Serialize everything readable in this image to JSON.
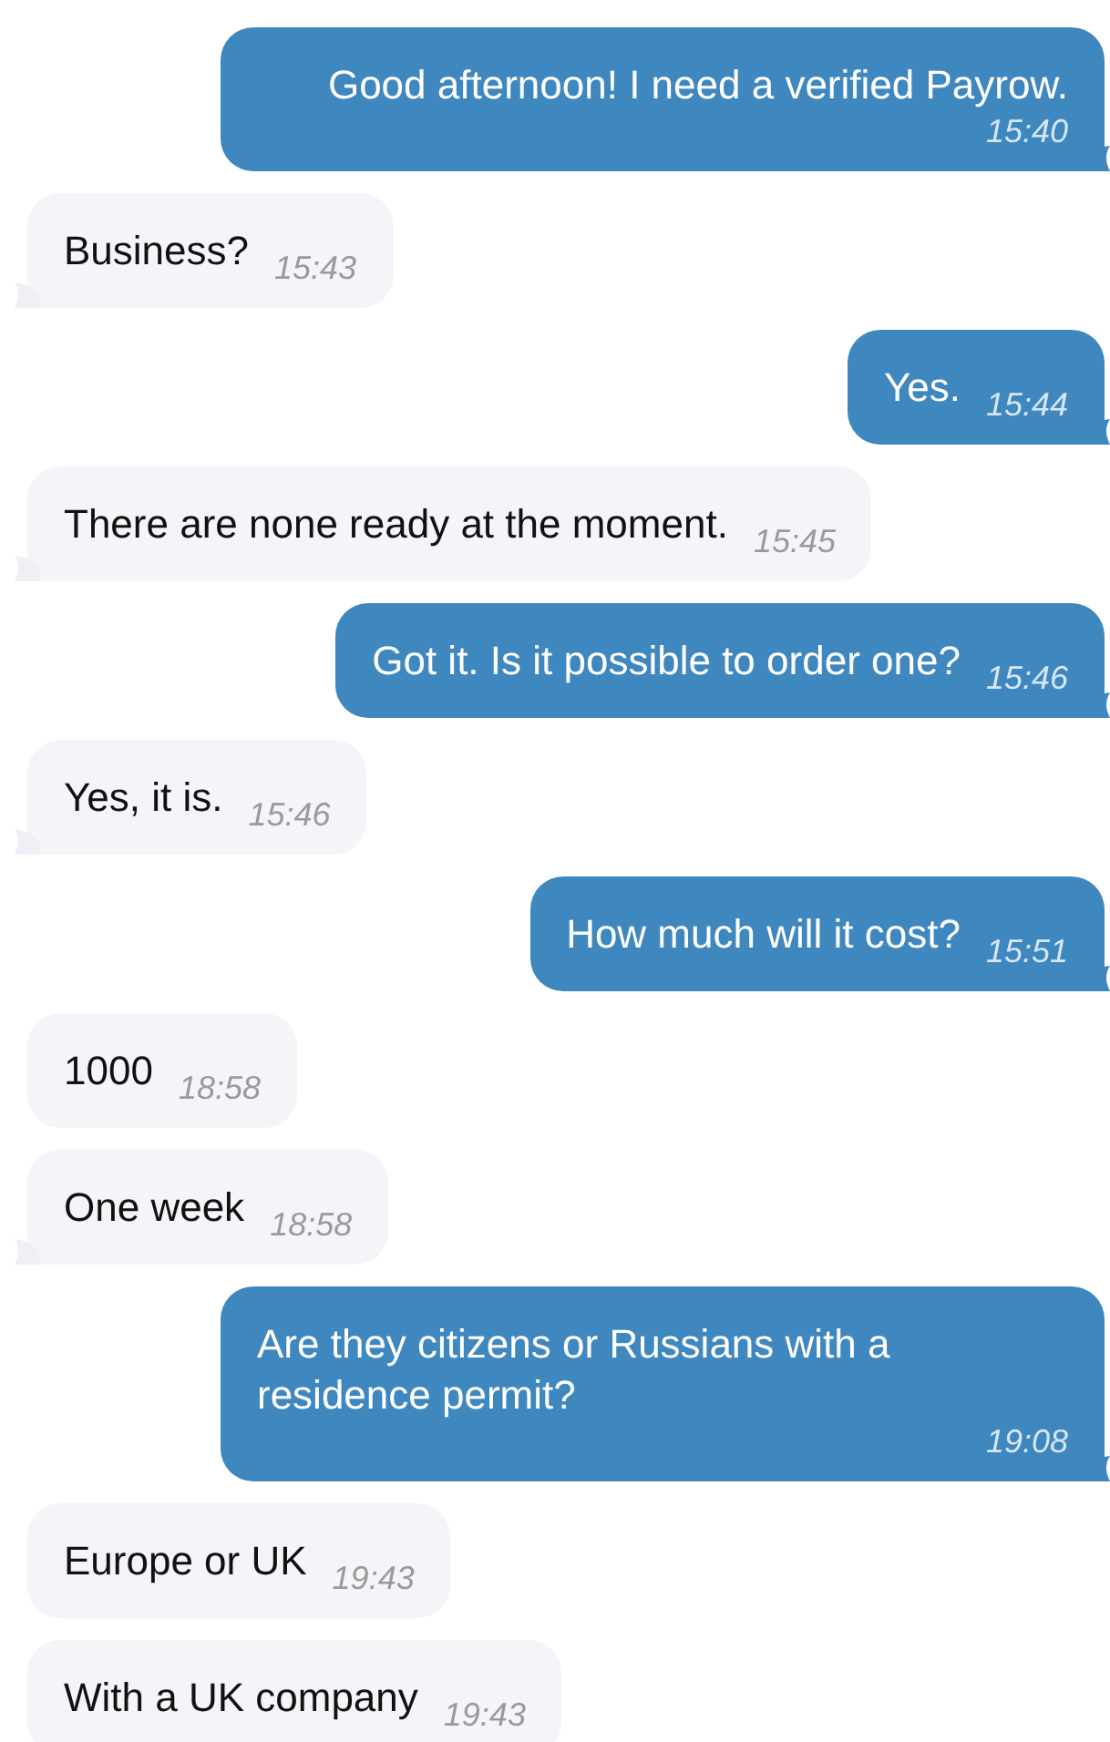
{
  "messages": [
    {
      "kind": "sent",
      "text": "Good afternoon! I need a verified Payrow.",
      "time": "15:40",
      "tail": true
    },
    {
      "kind": "received",
      "text": "Business?",
      "time": "15:43",
      "tail": true
    },
    {
      "kind": "sent",
      "text": "Yes.",
      "time": "15:44",
      "tail": true
    },
    {
      "kind": "received",
      "text": "There are none ready at the moment.",
      "time": "15:45",
      "tail": true
    },
    {
      "kind": "sent",
      "text": "Got it. Is it possible to order one?",
      "time": "15:46",
      "tail": true
    },
    {
      "kind": "received",
      "text": "Yes, it is.",
      "time": "15:46",
      "tail": true
    },
    {
      "kind": "sent",
      "text": "How much will it cost?",
      "time": "15:51",
      "tail": true
    },
    {
      "kind": "received",
      "text": "1000",
      "time": "18:58",
      "tail": false
    },
    {
      "kind": "received",
      "text": "One week",
      "time": "18:58",
      "tail": true
    },
    {
      "kind": "sent",
      "text": "Are they citizens or Russians with a residence permit?",
      "time": "19:08",
      "tail": true
    },
    {
      "kind": "received",
      "text": "Europe or UK",
      "time": "19:43",
      "tail": false
    },
    {
      "kind": "received",
      "text": "With a UK company",
      "time": "19:43",
      "tail": false
    }
  ]
}
